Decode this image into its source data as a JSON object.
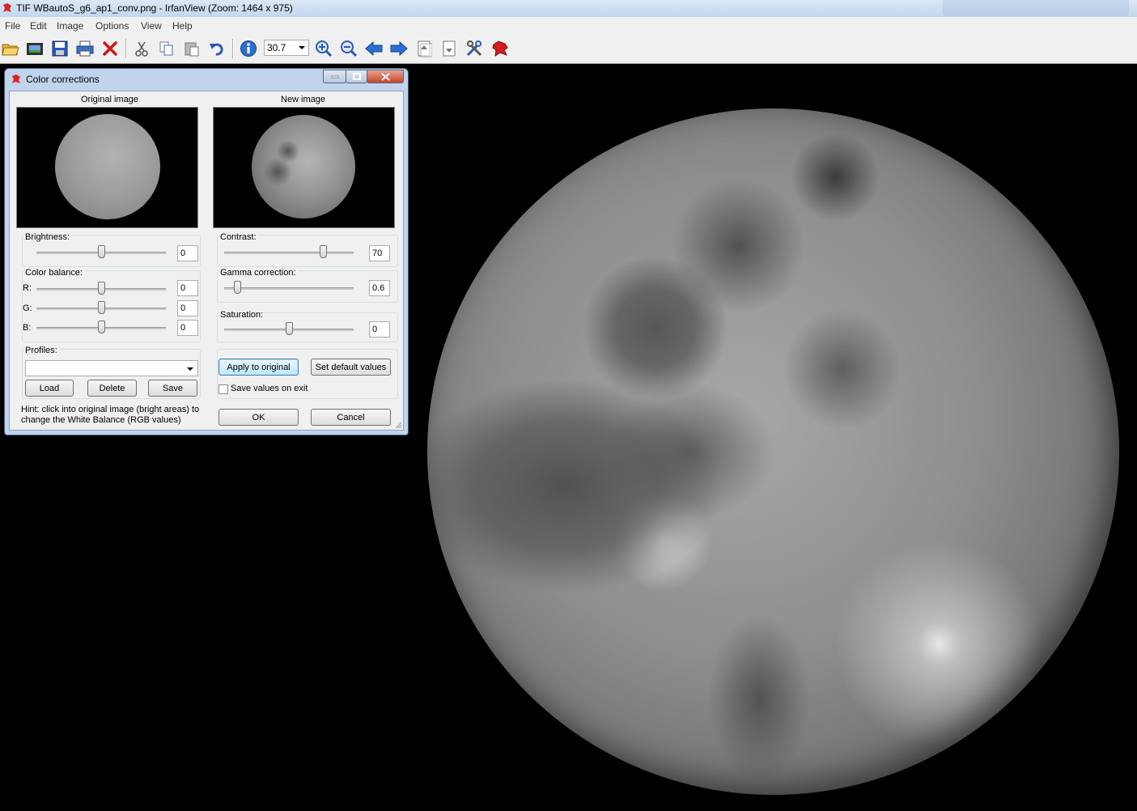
{
  "window": {
    "title": "TIF WBautoS_g6_ap1_conv.png - IrfanView (Zoom: 1464 x 975)"
  },
  "menu": {
    "items": [
      "File",
      "Edit",
      "Image",
      "Options",
      "View",
      "Help"
    ]
  },
  "toolbar": {
    "zoom_value": "30.7",
    "icons": [
      "open-folder-icon",
      "slideshow-icon",
      "save-icon",
      "print-icon",
      "delete-icon",
      "cut-icon",
      "copy-icon",
      "paste-icon",
      "undo-icon",
      "info-icon",
      "zoom-in-icon",
      "zoom-out-icon",
      "previous-icon",
      "next-icon",
      "first-page-icon",
      "last-page-icon",
      "settings-icon",
      "irfanview-logo-icon"
    ]
  },
  "dialog": {
    "title": "Color corrections",
    "original_label": "Original image",
    "new_label": "New image",
    "brightness": {
      "label": "Brightness:",
      "value": "0",
      "level": 0.5
    },
    "contrast": {
      "label": "Contrast:",
      "value": "70",
      "level": 0.76
    },
    "color_balance": {
      "label": "Color balance:",
      "r": {
        "label": "R:",
        "value": "0",
        "level": 0.5
      },
      "g": {
        "label": "G:",
        "value": "0",
        "level": 0.5
      },
      "b": {
        "label": "B:",
        "value": "0",
        "level": 0.5
      }
    },
    "gamma": {
      "label": "Gamma correction:",
      "value": "0.6",
      "level": 0.1
    },
    "saturation": {
      "label": "Saturation:",
      "value": "0",
      "level": 0.5
    },
    "profiles": {
      "label": "Profiles:",
      "selected": ""
    },
    "buttons": {
      "load": "Load",
      "delete": "Delete",
      "save": "Save",
      "apply": "Apply to original",
      "set_default": "Set default values",
      "ok": "OK",
      "cancel": "Cancel"
    },
    "save_values_label": "Save values on exit",
    "save_values_checked": false,
    "hint_line1": "Hint: click into original image (bright areas) to",
    "hint_line2": "change the White Balance (RGB values)"
  }
}
